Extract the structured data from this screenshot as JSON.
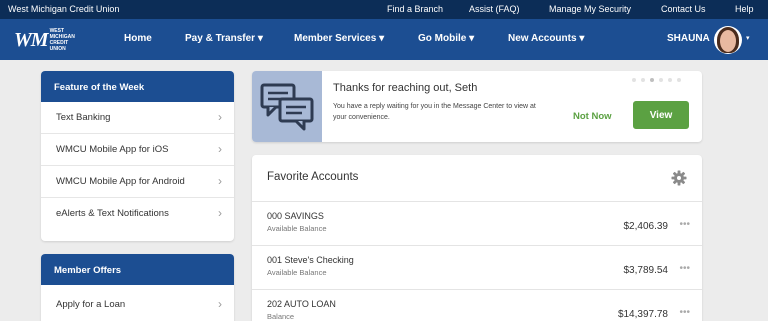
{
  "topbar": {
    "brand": "West Michigan Credit Union",
    "links": [
      "Find a Branch",
      "Assist (FAQ)",
      "Manage My Security",
      "Contact Us",
      "Help"
    ]
  },
  "logo": {
    "mark": "WM",
    "sub": "WEST MICHIGAN CREDIT UNION"
  },
  "nav": {
    "items": [
      "Home",
      "Pay & Transfer",
      "Member Services",
      "Go Mobile",
      "New Accounts"
    ],
    "dropdown_caret": "▾",
    "user": "SHAUNA"
  },
  "feature": {
    "title": "Feature of the Week",
    "items": [
      "Text Banking",
      "WMCU Mobile App for iOS",
      "WMCU Mobile App for Android",
      "eAlerts & Text Notifications"
    ]
  },
  "offers": {
    "title": "Member Offers",
    "items": [
      "Apply for a Loan"
    ]
  },
  "message": {
    "title": "Thanks for reaching out, Seth",
    "body": "You have a reply waiting for you in the Message Center to view at your convenience.",
    "not_now": "Not Now",
    "view": "View"
  },
  "favorites": {
    "title": "Favorite Accounts",
    "accounts": [
      {
        "name": "000 SAVINGS",
        "type": "Available Balance",
        "balance": "$2,406.39"
      },
      {
        "name": "001 Steve's Checking",
        "type": "Available Balance",
        "balance": "$3,789.54"
      },
      {
        "name": "202 AUTO LOAN",
        "type": "Balance",
        "balance": "$14,397.78"
      }
    ],
    "more_glyph": "•••"
  },
  "colors": {
    "topbar": "#0c2d57",
    "nav": "#1c4e92",
    "accent_green": "#5ba142",
    "icon_panel": "#a8b9d6"
  },
  "icons": [
    "chevron-right-icon",
    "chat-bubbles-icon",
    "gear-icon",
    "more-icon",
    "avatar"
  ]
}
